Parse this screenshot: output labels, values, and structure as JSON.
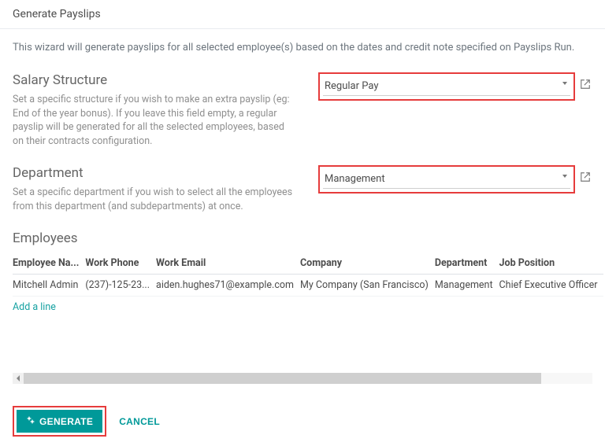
{
  "header": {
    "title": "Generate Payslips"
  },
  "intro": "This wizard will generate payslips for all selected employee(s) based on the dates and credit note specified on Payslips Run.",
  "salary": {
    "heading": "Salary Structure",
    "help": "Set a specific structure if you wish to make an extra payslip (eg: End of the year bonus). If you leave this field empty, a regular payslip will be generated for all the selected employees, based on their contracts configuration.",
    "value": "Regular Pay"
  },
  "department": {
    "heading": "Department",
    "help": "Set a specific department if you wish to select all the employees from this department (and subdepartments) at once.",
    "value": "Management"
  },
  "employees": {
    "heading": "Employees",
    "columns": {
      "name": "Employee Na...",
      "phone": "Work Phone",
      "email": "Work Email",
      "company": "Company",
      "department": "Department",
      "job": "Job Position"
    },
    "rows": [
      {
        "name": "Mitchell Admin",
        "phone": "(237)-125-23...",
        "email": "aiden.hughes71@example.com",
        "company": "My Company (San Francisco)",
        "department": "Management",
        "job": "Chief Executive Officer"
      }
    ],
    "add_line": "Add a line"
  },
  "footer": {
    "generate": "GENERATE",
    "cancel": "CANCEL"
  }
}
